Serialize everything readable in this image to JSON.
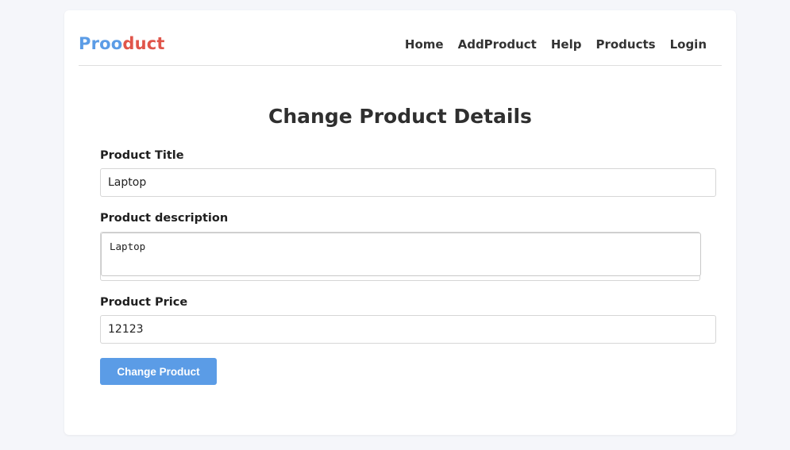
{
  "brand": {
    "part1": "Proo",
    "part2": "duct",
    "color1": "#5b9ce6",
    "color2": "#e0554a"
  },
  "nav": {
    "items": [
      {
        "label": "Home"
      },
      {
        "label": "AddProduct"
      },
      {
        "label": "Help"
      },
      {
        "label": "Products"
      },
      {
        "label": "Login"
      }
    ]
  },
  "page": {
    "title": "Change Product Details"
  },
  "form": {
    "title_label": "Product Title",
    "title_value": "Laptop",
    "description_label": "Product description",
    "description_value": "Laptop",
    "price_label": "Product Price",
    "price_value": "12123",
    "submit_label": "Change Product"
  },
  "colors": {
    "accent": "#5b9ce6",
    "brand_red": "#e0554a",
    "background": "#f5f6fa"
  }
}
